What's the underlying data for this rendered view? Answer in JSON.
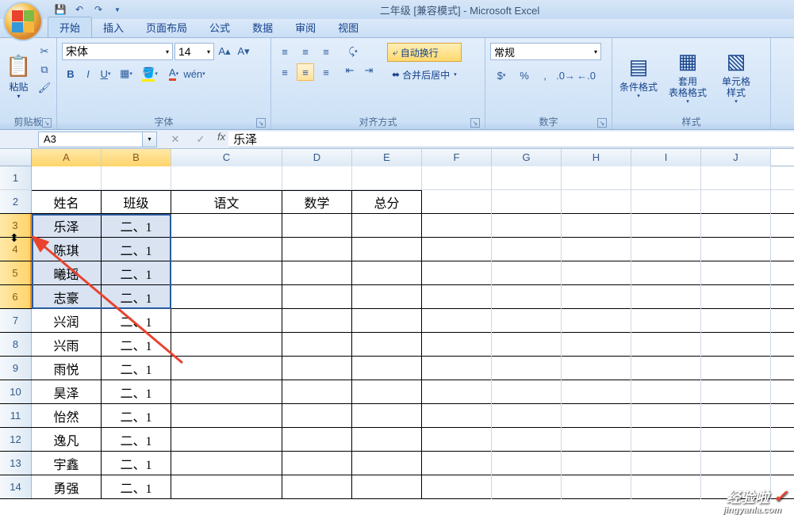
{
  "title": "二年级  [兼容模式] - Microsoft Excel",
  "tabs": [
    "开始",
    "插入",
    "页面布局",
    "公式",
    "数据",
    "审阅",
    "视图"
  ],
  "clipboard": {
    "group": "剪贴板",
    "paste": "粘贴"
  },
  "font": {
    "group": "字体",
    "name": "宋体",
    "size": "14"
  },
  "alignment": {
    "group": "对齐方式",
    "wrap": "自动换行",
    "merge": "合并后居中"
  },
  "number": {
    "group": "数字",
    "format": "常规"
  },
  "styles": {
    "group": "样式",
    "cond": "条件格式",
    "table": "套用\n表格格式",
    "cell": "单元格\n样式"
  },
  "namebox": "A3",
  "formula": "乐泽",
  "columns": [
    "A",
    "B",
    "C",
    "D",
    "E",
    "F",
    "G",
    "H",
    "I",
    "J"
  ],
  "headers": {
    "name": "姓名",
    "class": "班级",
    "chinese": "语文",
    "math": "数学",
    "total": "总分"
  },
  "rows": [
    {
      "n": "1"
    },
    {
      "n": "2",
      "name": "姓名",
      "class": "班级",
      "chinese": "语文",
      "math": "数学",
      "total": "总分",
      "hdr": true
    },
    {
      "n": "3",
      "name": "乐泽",
      "class": "二、1"
    },
    {
      "n": "4",
      "name": "陈琪",
      "class": "二、1"
    },
    {
      "n": "5",
      "name": "曦瑶",
      "class": "二、1"
    },
    {
      "n": "6",
      "name": "志豪",
      "class": "二、1"
    },
    {
      "n": "7",
      "name": "兴润",
      "class": "二、1"
    },
    {
      "n": "8",
      "name": "兴雨",
      "class": "二、1"
    },
    {
      "n": "9",
      "name": "雨悦",
      "class": "二、1"
    },
    {
      "n": "10",
      "name": "昊泽",
      "class": "二、1"
    },
    {
      "n": "11",
      "name": "怡然",
      "class": "二、1"
    },
    {
      "n": "12",
      "name": "逸凡",
      "class": "二、1"
    },
    {
      "n": "13",
      "name": "宇鑫",
      "class": "二、1"
    },
    {
      "n": "14",
      "name": "勇强",
      "class": "二、1"
    }
  ],
  "watermark": {
    "text": "经验啦",
    "url": "jingyanla.com"
  }
}
